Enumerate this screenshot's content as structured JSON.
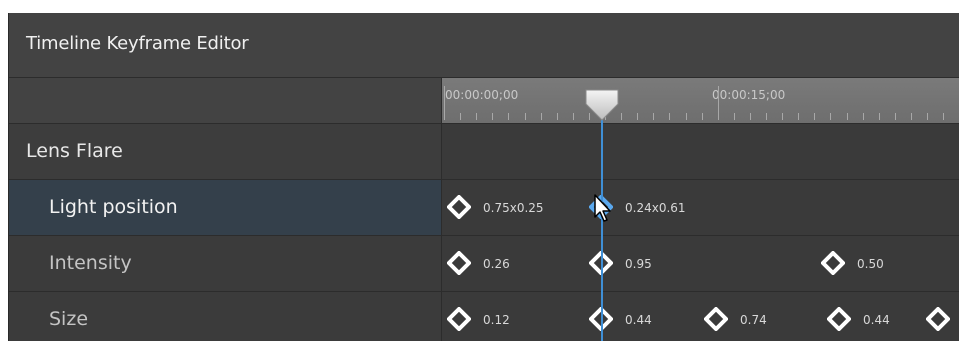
{
  "window": {
    "title": "Timeline Keyframe Editor"
  },
  "ruler": {
    "start_time": "00:00:00;00",
    "mid_time": "00:00:15;00"
  },
  "group": {
    "label": "Lens Flare"
  },
  "tracks": [
    {
      "label": "Light position",
      "selected": true,
      "keyframes": [
        {
          "value": "0.75x0.25",
          "selected": false
        },
        {
          "value": "0.24x0.61",
          "selected": true
        }
      ]
    },
    {
      "label": "Intensity",
      "selected": false,
      "keyframes": [
        {
          "value": "0.26",
          "selected": false
        },
        {
          "value": "0.95",
          "selected": false
        },
        {
          "value": "0.50",
          "selected": false
        }
      ]
    },
    {
      "label": "Size",
      "selected": false,
      "keyframes": [
        {
          "value": "0.12",
          "selected": false
        },
        {
          "value": "0.44",
          "selected": false
        },
        {
          "value": "0.74",
          "selected": false
        },
        {
          "value": "0.44",
          "selected": false
        },
        {
          "value": "",
          "selected": false
        }
      ]
    }
  ],
  "colors": {
    "accent": "#3f8fd6",
    "keyframe": "#ffffff",
    "selected_row": "#34404b"
  },
  "icons": {
    "keyframe": "diamond-keyframe-icon",
    "playhead": "playhead-handle-icon",
    "cursor": "mouse-pointer-icon"
  }
}
